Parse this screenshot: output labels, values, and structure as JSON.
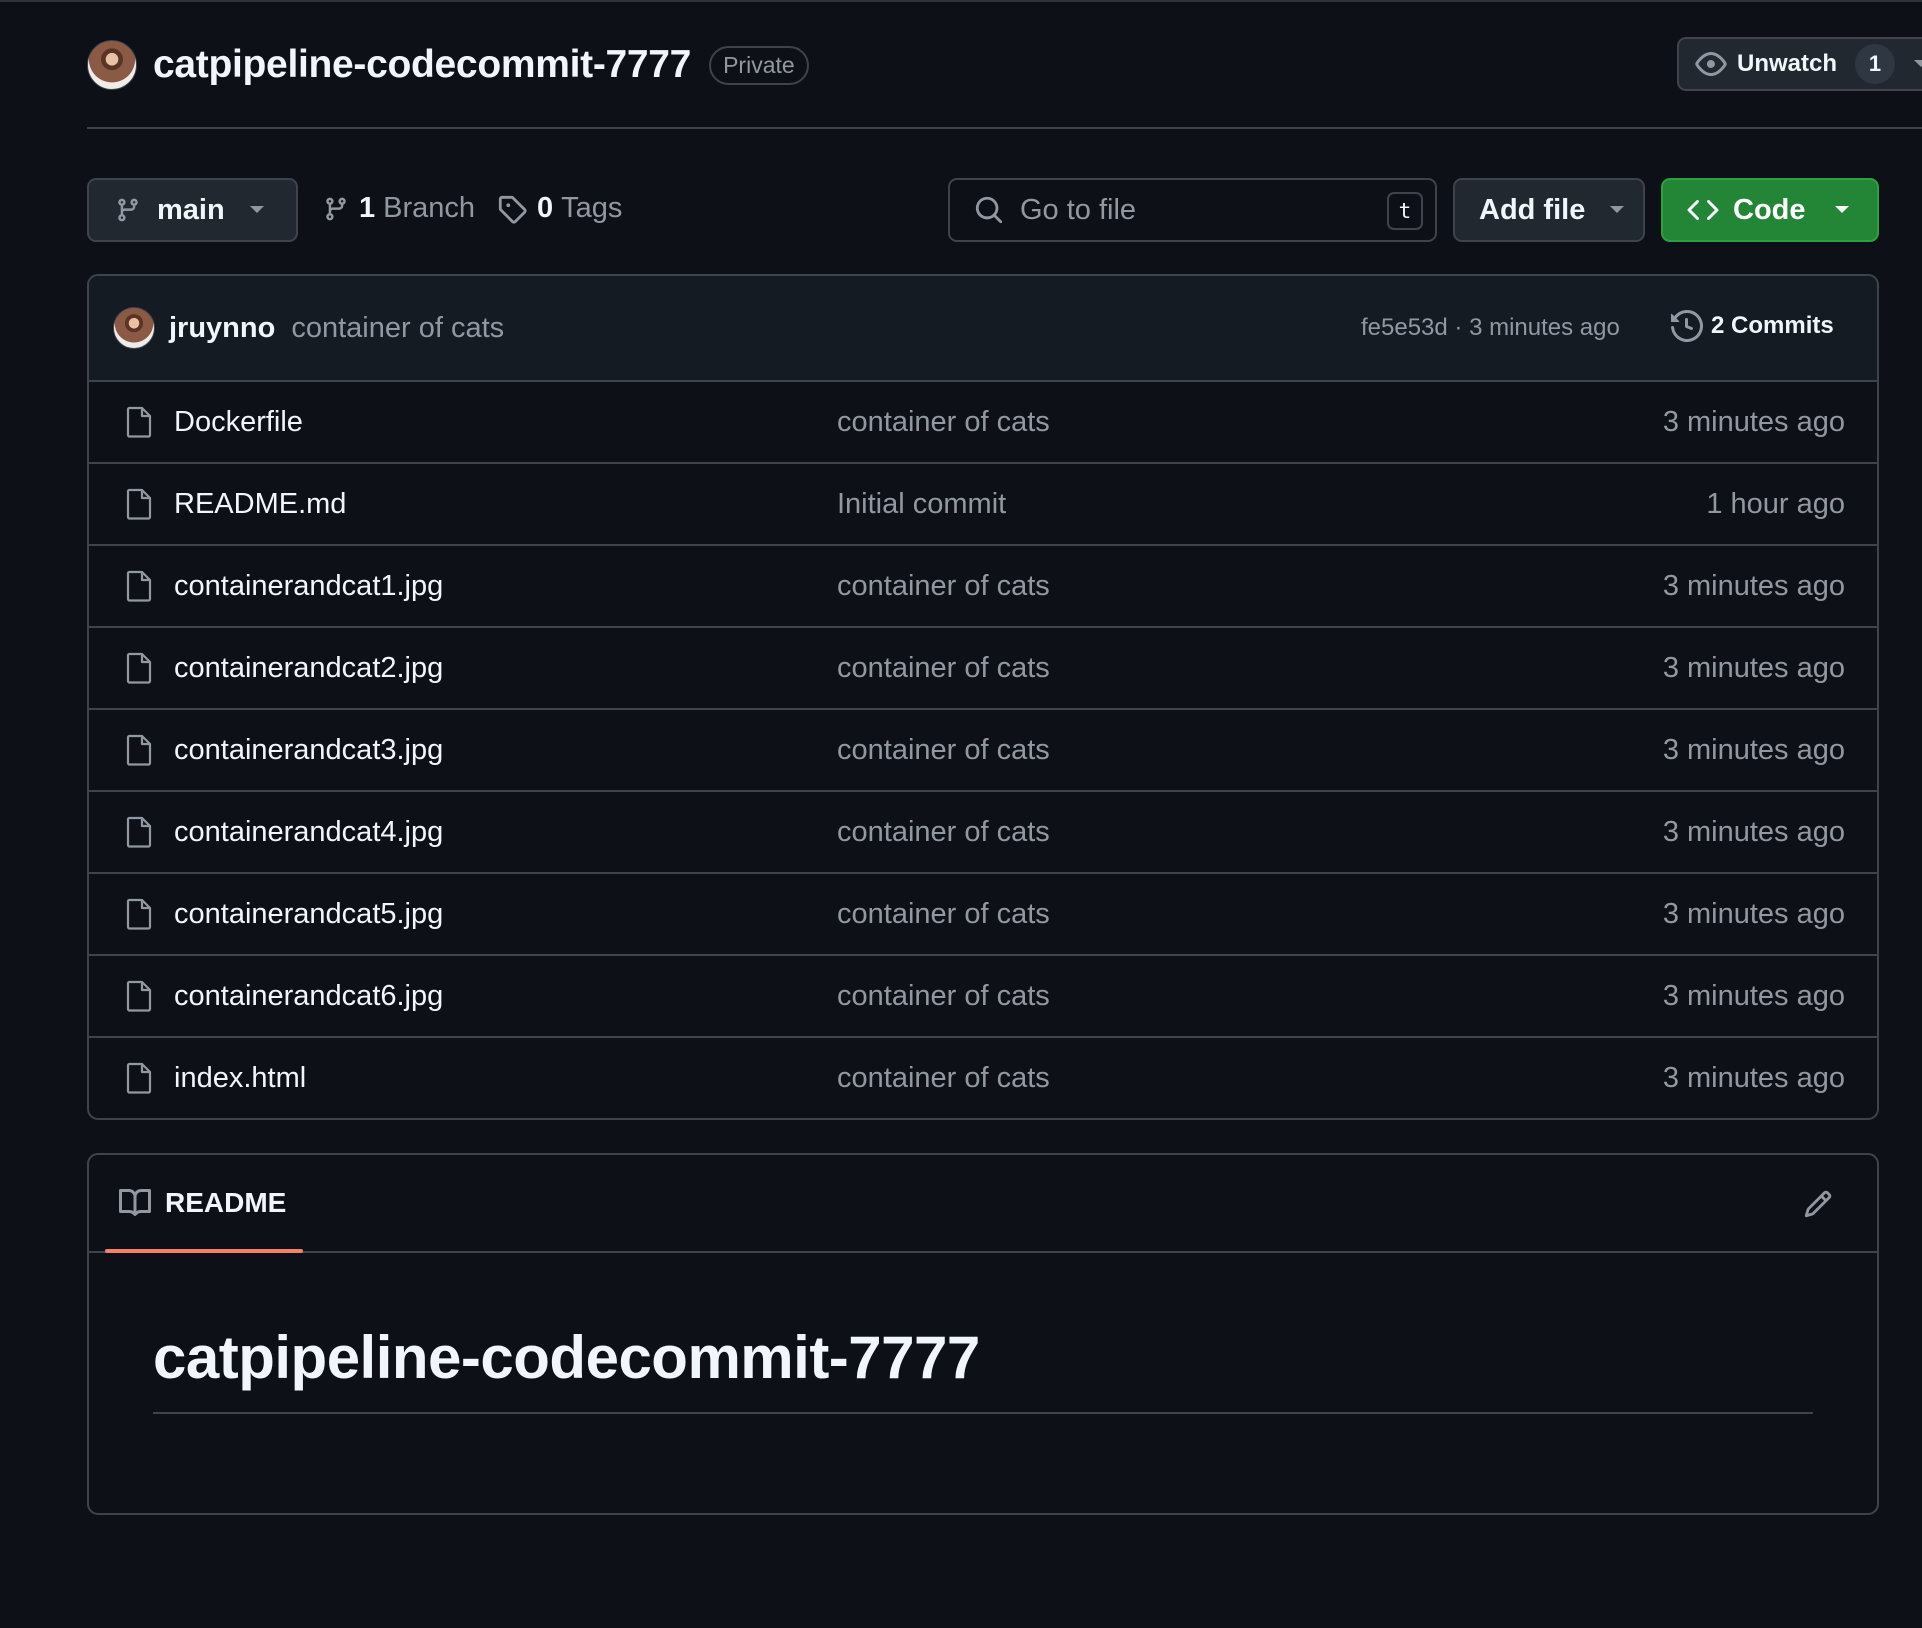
{
  "repo": {
    "name": "catpipeline-codecommit-7777",
    "visibility": "Private",
    "watch_label": "Unwatch",
    "watch_count": "1"
  },
  "toolbar": {
    "branch": "main",
    "branch_count": "1",
    "branch_label": "Branch",
    "tag_count": "0",
    "tag_label": "Tags",
    "goto_placeholder": "Go to file",
    "goto_shortcut": "t",
    "add_file_label": "Add file",
    "code_label": "Code"
  },
  "latest_commit": {
    "author": "jruynno",
    "message": "container of cats",
    "meta": "fe5e53d · 3 minutes ago",
    "commits_label": "2 Commits"
  },
  "files": [
    {
      "name": "Dockerfile",
      "message": "container of cats",
      "time": "3 minutes ago"
    },
    {
      "name": "README.md",
      "message": "Initial commit",
      "time": "1 hour ago"
    },
    {
      "name": "containerandcat1.jpg",
      "message": "container of cats",
      "time": "3 minutes ago"
    },
    {
      "name": "containerandcat2.jpg",
      "message": "container of cats",
      "time": "3 minutes ago"
    },
    {
      "name": "containerandcat3.jpg",
      "message": "container of cats",
      "time": "3 minutes ago"
    },
    {
      "name": "containerandcat4.jpg",
      "message": "container of cats",
      "time": "3 minutes ago"
    },
    {
      "name": "containerandcat5.jpg",
      "message": "container of cats",
      "time": "3 minutes ago"
    },
    {
      "name": "containerandcat6.jpg",
      "message": "container of cats",
      "time": "3 minutes ago"
    },
    {
      "name": "index.html",
      "message": "container of cats",
      "time": "3 minutes ago"
    }
  ],
  "readme": {
    "tab_label": "README",
    "heading": "catpipeline-codecommit-7777"
  },
  "colors": {
    "background": "#0d1117",
    "border": "#3d444d",
    "code_button": "#238636",
    "readme_underline": "#f78166",
    "muted_text": "#9198a1"
  }
}
